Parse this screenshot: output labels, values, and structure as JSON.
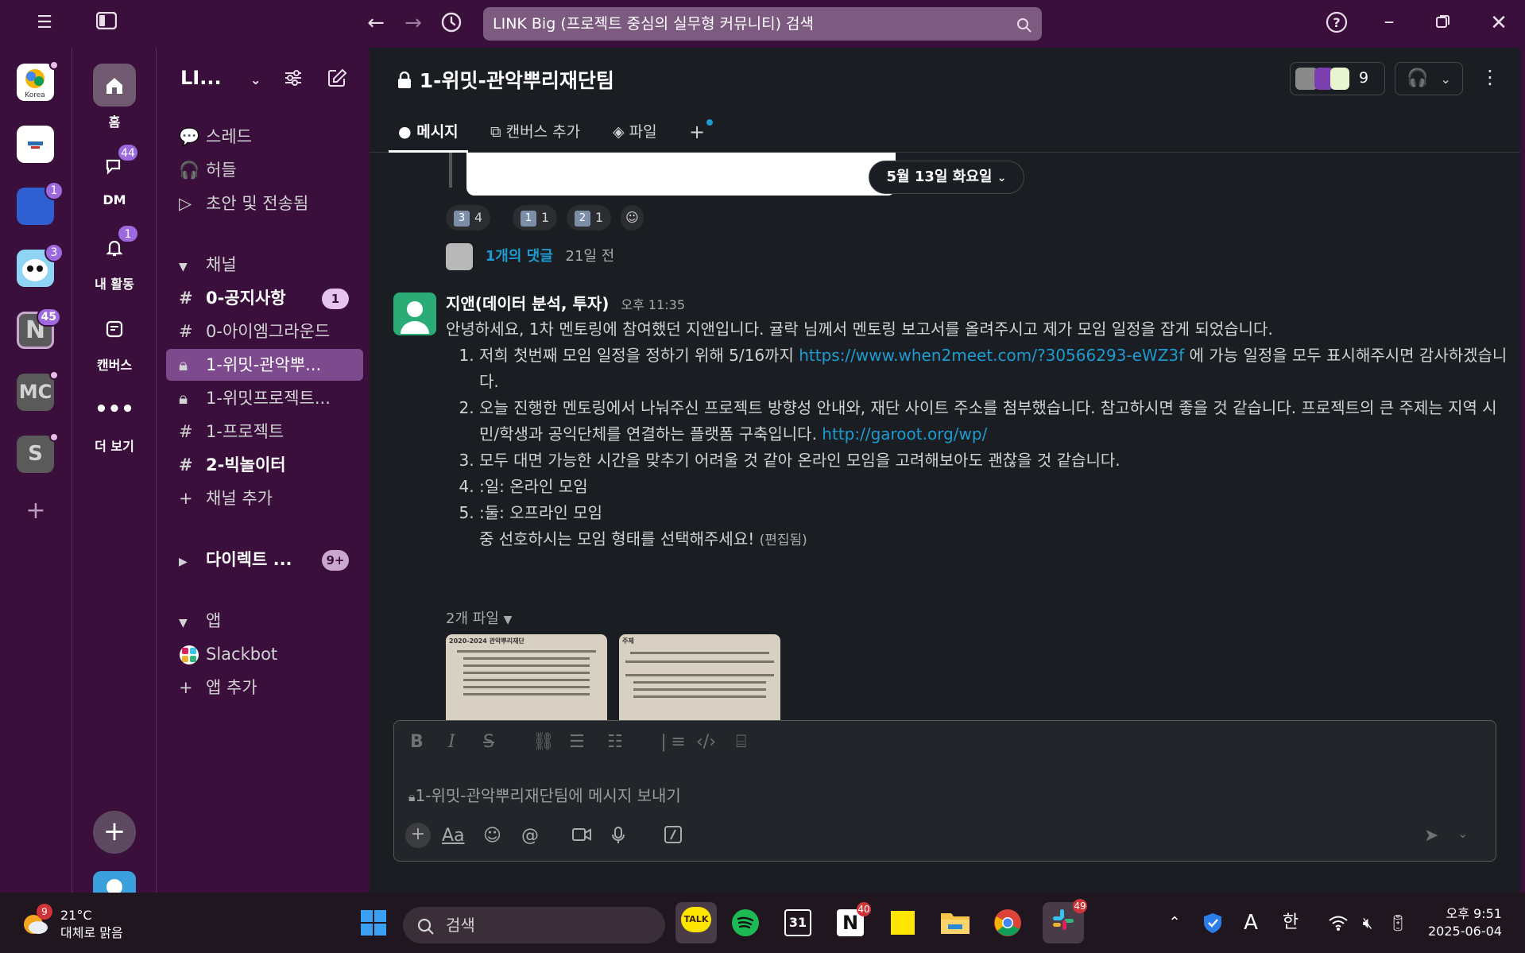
{
  "titlebar": {
    "search_text": "LINK Big (프로젝트 중심의 실무형 커뮤니티) 검색"
  },
  "workspaces": {
    "items": [
      {
        "label": "Korea",
        "badge": ""
      },
      {
        "label": "",
        "badge": ""
      },
      {
        "label": "",
        "badge": "1"
      },
      {
        "label": "",
        "badge": "3"
      },
      {
        "label": "N",
        "badge": "45"
      },
      {
        "label": "MC",
        "badge": ""
      },
      {
        "label": "S",
        "badge": ""
      }
    ]
  },
  "nav": {
    "home": "홈",
    "dm": "DM",
    "dm_badge": "44",
    "activity": "내 활동",
    "activity_badge": "1",
    "canvas": "캔버스",
    "more": "더 보기"
  },
  "sidebar": {
    "workspace_name": "LI...",
    "threads": "스레드",
    "huddles": "허들",
    "drafts": "초안 및 전송됨",
    "channels_header": "채널",
    "channels": [
      {
        "name": "0-공지사항",
        "badge": "1"
      },
      {
        "name": "0-아이엠그라운드",
        "badge": ""
      },
      {
        "name": "1-위밋-관악뿌...",
        "badge": ""
      },
      {
        "name": "1-위밋프로젝트...",
        "badge": ""
      },
      {
        "name": "1-프로젝트",
        "badge": ""
      },
      {
        "name": "2-빅놀이터",
        "badge": ""
      }
    ],
    "add_channel": "채널 추가",
    "direct_header": "다이렉트 ...",
    "direct_badge": "9+",
    "apps_header": "앱",
    "slackbot": "Slackbot",
    "add_app": "앱 추가"
  },
  "channel": {
    "title": "1-위밋-관악뿌리재단팀",
    "member_count": "9",
    "tabs": {
      "messages": "메시지",
      "canvas": "캔버스 추가",
      "files": "파일"
    }
  },
  "feed": {
    "date_divider": "5월 13일 화요일",
    "reactions": [
      {
        "emoji": "3️⃣",
        "count": "4"
      },
      {
        "emoji": "1️⃣",
        "count": "1"
      },
      {
        "emoji": "2️⃣",
        "count": "1"
      }
    ],
    "thread_replies": "1개의 댓글",
    "thread_ago": "21일 전",
    "message": {
      "author": "지앤(데이터 분석, 투자)",
      "time": "오후 11:35",
      "intro": "안녕하세요, 1차 멘토링에 참여했던 지앤입니다. 귤락 님께서 멘토링 보고서를 올려주시고 제가 모임 일정을 잡게 되었습니다.",
      "item1_pre": "저희 첫번째 모임 일정을 정하기 위해 5/16까지 ",
      "item1_link": "https://www.when2meet.com/?30566293-eWZ3f",
      "item1_post": " 에 가능 일정을 모두 표시해주시면 감사하겠습니다.",
      "item2_pre": "오늘 진행한 멘토링에서 나눠주신 프로젝트 방향성 안내와, 재단 사이트 주소를 첨부했습니다. 참고하시면 좋을 것 같습니다. 프로젝트의 큰 주제는 지역 시민/학생과 공익단체를 연결하는 플랫폼 구축입니다. ",
      "item2_link": "http://garoot.org/wp/",
      "item3": "모두 대면 가능한 시간을 맞추기 어려울 것 같아 온라인 모임을 고려해보아도 괜찮을 것 같습니다.",
      "item4": ":일: 온라인 모임",
      "item5": ":둘: 오프라인 모임",
      "outro": "중 선호하시는 모임 형태를 선택해주세요!",
      "edited": "(편집됨)"
    },
    "files_label": "2개 파일",
    "file1_heading": "2020-2024 관악뿌리재단",
    "file2_heading": "주제"
  },
  "composer": {
    "placeholder": "1-위밋-관악뿌리재단팀에 메시지 보내기"
  },
  "taskbar": {
    "weather_temp": "21°C",
    "weather_desc": "대체로 맑음",
    "weather_badge": "9",
    "search": "검색",
    "time": "오후 9:51",
    "date": "2025-06-04",
    "notion_badge": "40",
    "slack_badge": "49",
    "calendar_day": "31",
    "ime_lang": "한",
    "ime_letter": "A"
  },
  "colors": {
    "aubergine": "#3b0f3c",
    "main_bg": "#1a1d21",
    "active_channel": "#7d4a8e",
    "link": "#1d9bd1",
    "badge": "#9c6ade"
  }
}
